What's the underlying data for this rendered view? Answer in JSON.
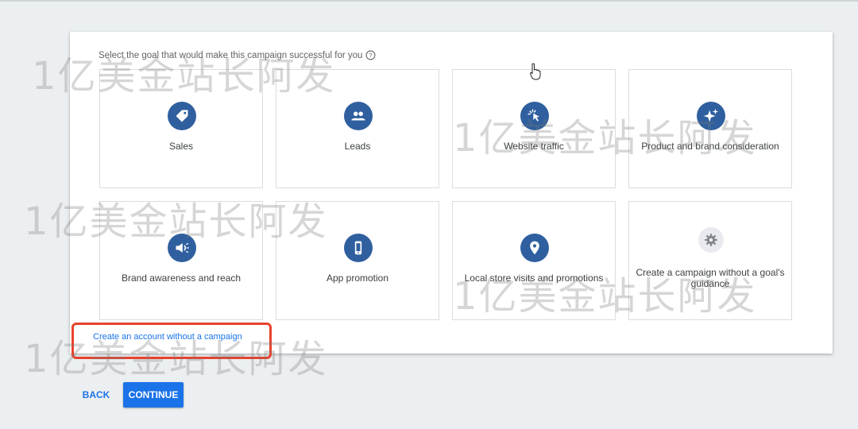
{
  "prompt": {
    "text": "Select the goal that would make this campaign successful for you"
  },
  "goals": [
    {
      "label": "Sales",
      "icon": "tag-icon"
    },
    {
      "label": "Leads",
      "icon": "people-icon"
    },
    {
      "label": "Website traffic",
      "icon": "cursor-click-icon"
    },
    {
      "label": "Product and brand consideration",
      "icon": "sparkle-icon"
    },
    {
      "label": "Brand awareness and reach",
      "icon": "megaphone-icon"
    },
    {
      "label": "App promotion",
      "icon": "phone-icon"
    },
    {
      "label": "Local store visits and promotions",
      "icon": "location-pin-icon"
    },
    {
      "label": "Create a campaign without a goal's guidance",
      "icon": "gear-icon"
    }
  ],
  "link": {
    "text": "Create an account without a campaign"
  },
  "buttons": {
    "back": "BACK",
    "continue": "CONTINUE"
  },
  "watermark": {
    "text": "1亿美金站长阿发"
  },
  "colors": {
    "accent": "#1a73e8",
    "icon_circle": "#2f5f9e",
    "highlight": "#e8432d"
  }
}
